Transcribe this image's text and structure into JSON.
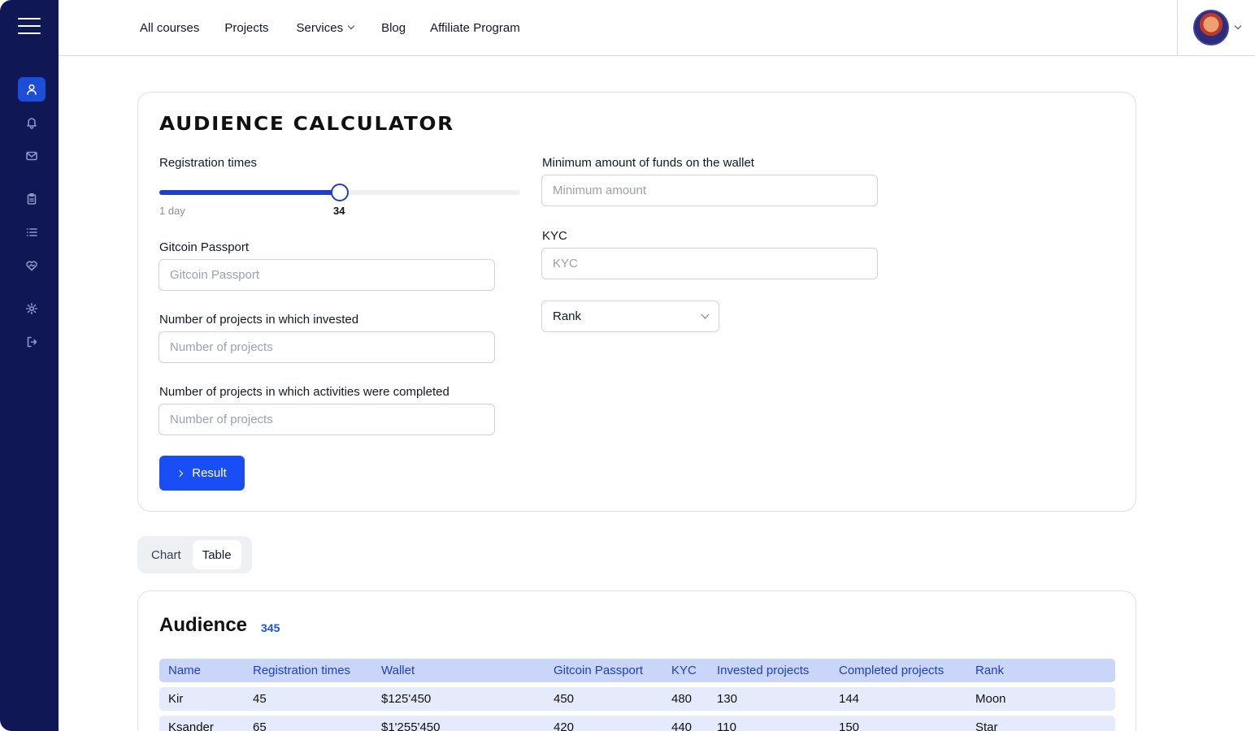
{
  "sidebar": {
    "icons": [
      "user-icon",
      "bell-icon",
      "mail-icon",
      "clipboard-icon",
      "list-icon",
      "heart-handshake-icon",
      "gear-icon",
      "logout-icon"
    ]
  },
  "nav": {
    "items": [
      {
        "label": "All courses"
      },
      {
        "label": "Projects"
      },
      {
        "label": "Services"
      },
      {
        "label": "Blog"
      },
      {
        "label": "Affiliate Program"
      }
    ]
  },
  "calculator": {
    "title": "AUDIENCE CALCULATOR",
    "registration": {
      "label": "Registration times",
      "min_label": "1 day",
      "value": "34",
      "fill_fraction": 0.5
    },
    "gitcoin": {
      "label": "Gitcoin Passport",
      "placeholder": "Gitcoin Passport"
    },
    "invested": {
      "label": "Number of projects in which invested",
      "placeholder": "Number of projects"
    },
    "activities": {
      "label": "Number of projects in which activities were completed",
      "placeholder": "Number of projects"
    },
    "min_funds": {
      "label": "Minimum amount of funds on the wallet",
      "placeholder": "Minimum amount"
    },
    "kyc": {
      "label": "KYC",
      "placeholder": "KYC"
    },
    "rank": {
      "value": "Rank"
    },
    "result_label": "Result"
  },
  "tabs": [
    {
      "label": "Chart"
    },
    {
      "label": "Table"
    }
  ],
  "audience": {
    "title": "Audience",
    "count": "345",
    "columns": [
      "Name",
      "Registration times",
      "Wallet",
      "Gitcoin Passport",
      "KYC",
      "Invested projects",
      "Completed projects",
      "Rank"
    ],
    "rows": [
      [
        "Kir",
        "45",
        "$125'450",
        "450",
        "480",
        "130",
        "144",
        "Moon"
      ],
      [
        "Ksander",
        "65",
        "$1'255'450",
        "420",
        "440",
        "110",
        "150",
        "Star"
      ]
    ]
  },
  "colors": {
    "sidebar_bg": "#0f1754",
    "accent": "#1a4ef5",
    "table_head_bg": "#c9d6f9",
    "table_row_bg": "#e5ebfb"
  }
}
